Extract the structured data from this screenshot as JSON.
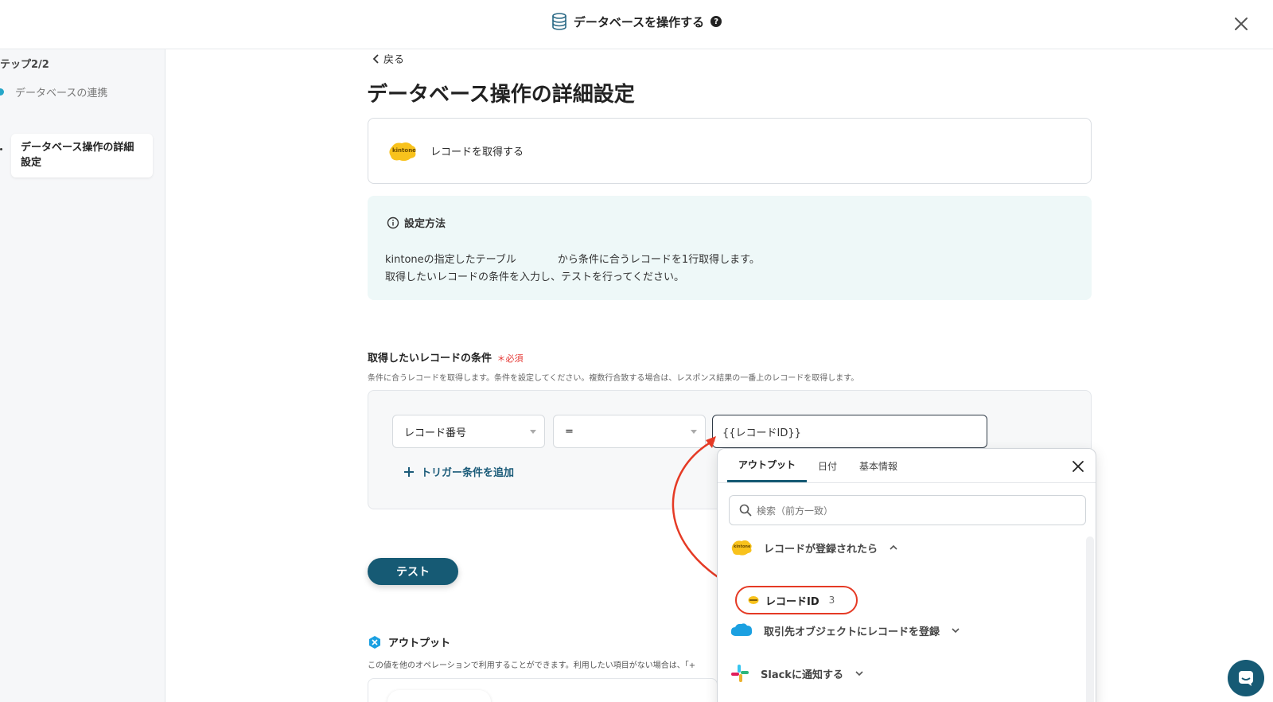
{
  "header": {
    "title": "データベースを操作する",
    "help": "?"
  },
  "sidebar": {
    "step": "テップ2/2",
    "items": [
      {
        "label": "データベースの連携"
      },
      {
        "label": "データベース操作の詳細設定"
      }
    ]
  },
  "main": {
    "back_label": "戻る",
    "page_title": "データベース操作の詳細設定",
    "action": {
      "logo_text": "kintone",
      "label": "レコードを取得する"
    },
    "info": {
      "heading": "設定方法",
      "line1": "kintoneの指定したテーブル　　　　から条件に合うレコードを1行取得します。",
      "line2": "取得したいレコードの条件を入力し、テストを行ってください。"
    },
    "condition": {
      "title": "取得したいレコードの条件",
      "required": "＊必須",
      "description": "条件に合うレコードを取得します。条件を設定してください。複数行合致する場合は、レスポンス結果の一番上のレコードを取得します。",
      "field_select": "レコード番号",
      "operator_select": "=",
      "value": "{{レコードID}}",
      "add_label": "トリガー条件を追加"
    },
    "test_label": "テスト",
    "output": {
      "title": "アウトプット",
      "description": "この値を他のオペレーションで利用することができます。利用したい項目がない場合は、「+"
    }
  },
  "popup": {
    "tabs": [
      "アウトプット",
      "日付",
      "基本情報"
    ],
    "search_placeholder": "検索（前方一致）",
    "groups": [
      {
        "label": "レコードが登録されたら",
        "logo_text": "kintone"
      },
      {
        "label": "取引先オブジェクトにレコードを登録"
      },
      {
        "label": "Slackに通知する"
      }
    ],
    "item": {
      "label": "レコードID",
      "count": "3"
    }
  },
  "colors": {
    "accent": "#165a74",
    "highlight": "#e53a25",
    "kintone": "#f8c21c",
    "salesforce": "#1ba0e1"
  }
}
